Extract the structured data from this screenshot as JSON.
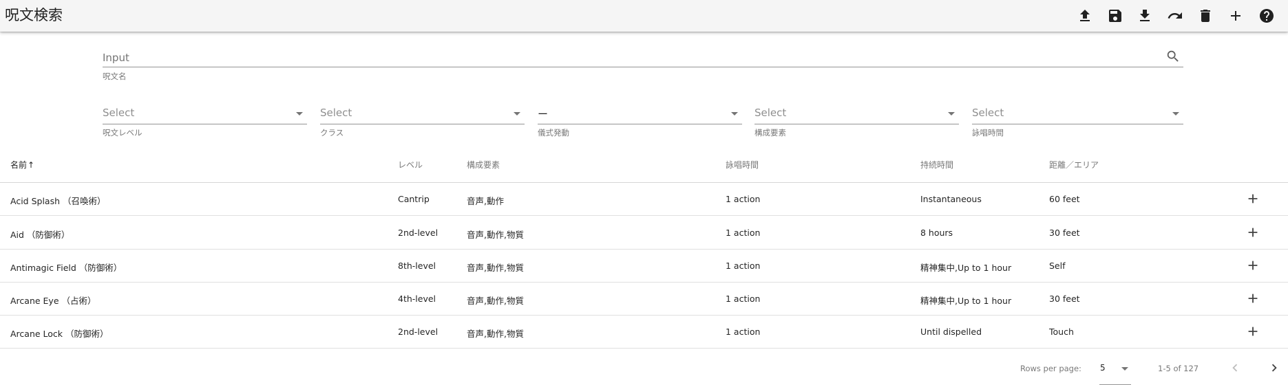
{
  "app": {
    "title": "呪文検索"
  },
  "toolbar": {
    "actions": [
      {
        "name": "upload-icon"
      },
      {
        "name": "save-icon"
      },
      {
        "name": "download-icon"
      },
      {
        "name": "redo-icon"
      },
      {
        "name": "delete-icon"
      },
      {
        "name": "add-icon"
      },
      {
        "name": "help-icon"
      }
    ]
  },
  "search": {
    "placeholder": "Input",
    "value": "",
    "hint": "呪文名"
  },
  "filters": [
    {
      "value": "Select",
      "hint": "呪文レベル"
    },
    {
      "value": "Select",
      "hint": "クラス"
    },
    {
      "value": "ー",
      "hint": "儀式発動"
    },
    {
      "value": "Select",
      "hint": "構成要素"
    },
    {
      "value": "Select",
      "hint": "詠唱時間"
    }
  ],
  "table": {
    "headers": {
      "name": "名前",
      "level": "レベル",
      "components": "構成要素",
      "casting_time": "詠唱時間",
      "duration": "持続時間",
      "range": "距離／エリア"
    },
    "sort_indicator": "↑",
    "rows": [
      {
        "name": "Acid Splash （召喚術）",
        "level": "Cantrip",
        "components": "音声,動作",
        "casting_time": "1 action",
        "duration": "Instantaneous",
        "range": "60 feet"
      },
      {
        "name": "Aid （防御術）",
        "level": "2nd-level",
        "components": "音声,動作,物質",
        "casting_time": "1 action",
        "duration": "8 hours",
        "range": "30 feet"
      },
      {
        "name": "Antimagic Field （防御術）",
        "level": "8th-level",
        "components": "音声,動作,物質",
        "casting_time": "1 action",
        "duration": "精神集中,Up to 1 hour",
        "range": "Self"
      },
      {
        "name": "Arcane Eye （占術）",
        "level": "4th-level",
        "components": "音声,動作,物質",
        "casting_time": "1 action",
        "duration": "精神集中,Up to 1 hour",
        "range": "30 feet"
      },
      {
        "name": "Arcane Lock （防御術）",
        "level": "2nd-level",
        "components": "音声,動作,物質",
        "casting_time": "1 action",
        "duration": "Until dispelled",
        "range": "Touch"
      }
    ]
  },
  "pagination": {
    "rows_per_page_label": "Rows per page:",
    "rows_per_page": "5",
    "range_text": "1-5 of 127"
  }
}
